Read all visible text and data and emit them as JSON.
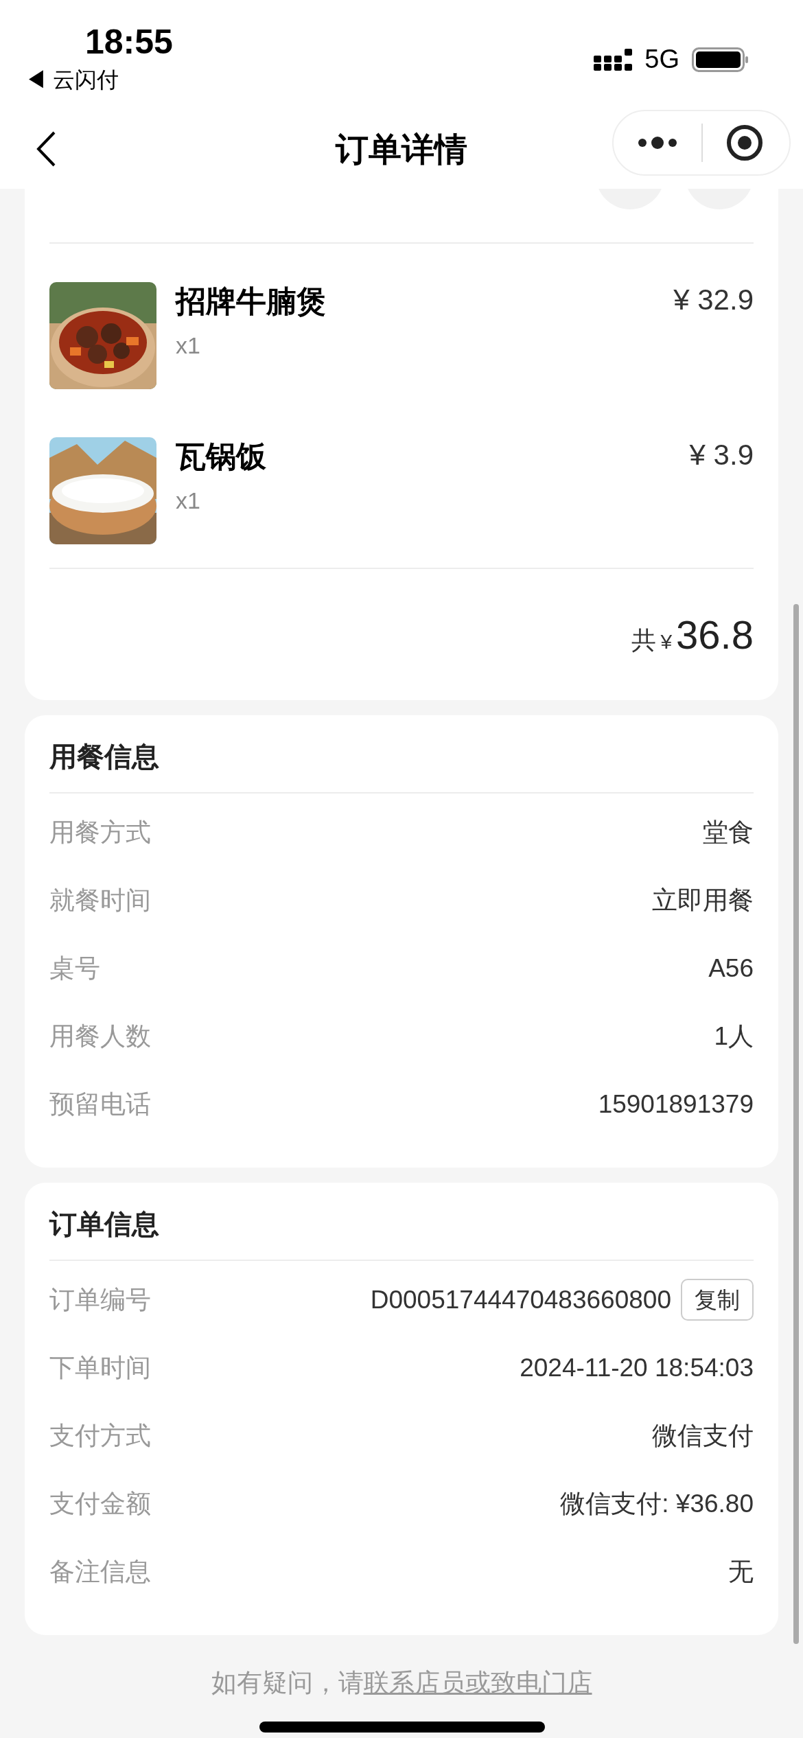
{
  "status_bar": {
    "time": "18:55",
    "back_app": "◀ 云闪付",
    "network": "5G"
  },
  "nav": {
    "title": "订单详情"
  },
  "items": [
    {
      "name": "招牌牛腩煲",
      "qty": "x1",
      "price": "¥ 32.9",
      "kind": "stew"
    },
    {
      "name": "瓦锅饭",
      "qty": "x1",
      "price": "¥ 3.9",
      "kind": "rice"
    }
  ],
  "total": {
    "label": "共",
    "currency": "¥",
    "amount": "36.8"
  },
  "dining": {
    "title": "用餐信息",
    "rows": [
      {
        "label": "用餐方式",
        "value": "堂食"
      },
      {
        "label": "就餐时间",
        "value": "立即用餐"
      },
      {
        "label": "桌号",
        "value": "A56"
      },
      {
        "label": "用餐人数",
        "value": "1人"
      },
      {
        "label": "预留电话",
        "value": "15901891379"
      }
    ]
  },
  "order": {
    "title": "订单信息",
    "rows": [
      {
        "label": "订单编号",
        "value": "D00051744470483660800",
        "action": "复制"
      },
      {
        "label": "下单时间",
        "value": "2024-11-20 18:54:03"
      },
      {
        "label": "支付方式",
        "value": "微信支付"
      },
      {
        "label": "支付金额",
        "value": "微信支付: ¥36.80"
      },
      {
        "label": "备注信息",
        "value": "无"
      }
    ]
  },
  "footer": {
    "text": "如有疑问，请",
    "link": "联系店员或致电门店"
  }
}
